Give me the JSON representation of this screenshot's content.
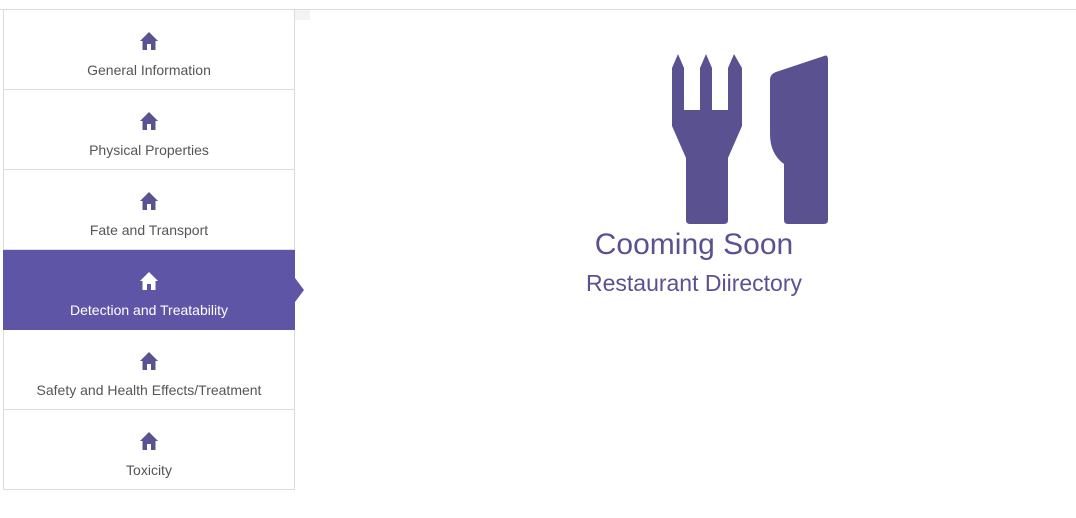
{
  "sidebar": {
    "items": [
      {
        "label": "General Information",
        "icon": "home-icon",
        "active": false
      },
      {
        "label": "Physical Properties",
        "icon": "home-icon",
        "active": false
      },
      {
        "label": "Fate and Transport",
        "icon": "home-icon",
        "active": false
      },
      {
        "label": "Detection and Treatability",
        "icon": "home-icon",
        "active": true
      },
      {
        "label": "Safety and Health Effects/Treatment",
        "icon": "home-icon",
        "active": false
      },
      {
        "label": "Toxicity",
        "icon": "home-icon",
        "active": false
      }
    ]
  },
  "main": {
    "icon": "fork-knife-icon",
    "title": "Cooming Soon",
    "subtitle": "Restaurant Diirectory"
  },
  "colors": {
    "accent": "#5f55a6",
    "icon": "#5a5290",
    "text": "#555555"
  }
}
